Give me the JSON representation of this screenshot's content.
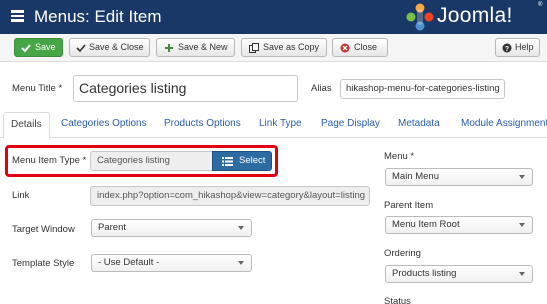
{
  "header": {
    "title": "Menus: Edit Item",
    "logo_text": "Joomla!",
    "logo_trademark": "®",
    "menu_icon": "list-icon"
  },
  "toolbar": {
    "save_label": "Save",
    "save_close_label": "Save & Close",
    "save_new_label": "Save & New",
    "save_copy_label": "Save as Copy",
    "close_label": "Close",
    "help_label": "Help",
    "colors": {
      "save_bg": "#46a546",
      "header_bg": "#1a3867"
    }
  },
  "form": {
    "menu_title_label": "Menu Title *",
    "menu_title_value": "Categories listing",
    "alias_label": "Alias",
    "alias_value": "hikashop-menu-for-categories-listing"
  },
  "tabs": [
    {
      "label": "Details"
    },
    {
      "label": "Categories Options"
    },
    {
      "label": "Products Options"
    },
    {
      "label": "Link Type"
    },
    {
      "label": "Page Display"
    },
    {
      "label": "Metadata"
    },
    {
      "label": "Module Assignment"
    }
  ],
  "details": {
    "menu_item_type_label": "Menu Item Type *",
    "menu_item_type_value": "Categories listing",
    "select_label": "Select",
    "link_label": "Link",
    "link_value": "index.php?option=com_hikashop&view=category&layout=listing",
    "target_window_label": "Target Window",
    "target_window_value": "Parent",
    "template_style_label": "Template Style",
    "template_style_value": "- Use Default -",
    "highlight_color": "#e00012"
  },
  "sidebar": {
    "menu_label": "Menu *",
    "menu_value": "Main Menu",
    "parent_item_label": "Parent Item",
    "parent_item_value": "Menu Item Root",
    "ordering_label": "Ordering",
    "ordering_value": "Products listing",
    "status_label": "Status"
  }
}
